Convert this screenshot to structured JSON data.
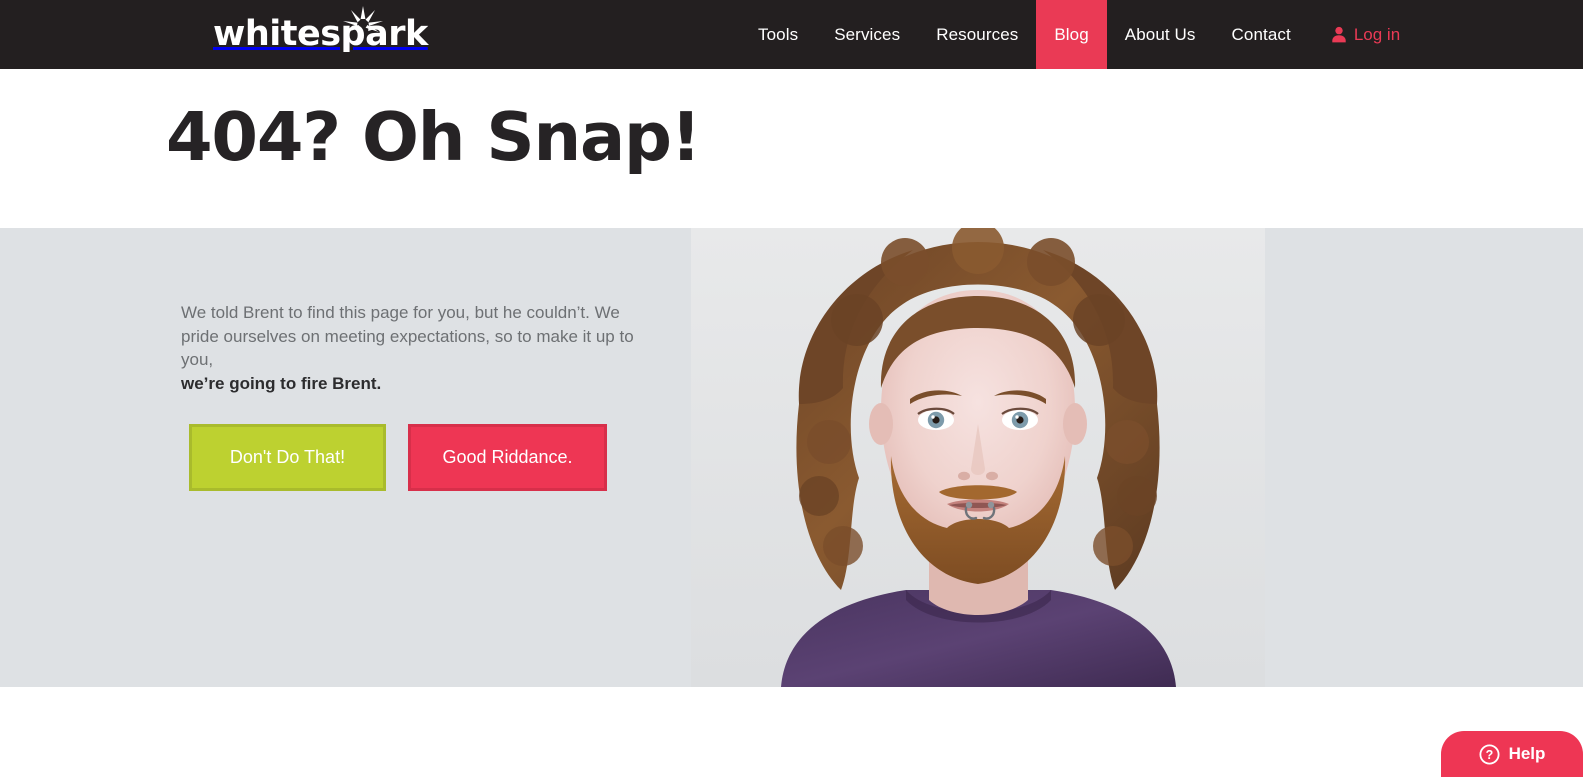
{
  "header": {
    "logo_text": "whitespark",
    "logo_icon": "spark-burst-icon",
    "nav": [
      {
        "label": "Tools",
        "active": false
      },
      {
        "label": "Services",
        "active": false
      },
      {
        "label": "Resources",
        "active": false
      },
      {
        "label": "Blog",
        "active": true
      },
      {
        "label": "About Us",
        "active": false
      },
      {
        "label": "Contact",
        "active": false
      }
    ],
    "login": {
      "label": "Log in",
      "icon": "user-icon"
    },
    "colors": {
      "background": "#231f20",
      "nav_text": "#ffffff",
      "accent": "#ea3a55"
    }
  },
  "title_band": {
    "title": "404? Oh Snap!",
    "background": "#ffffff",
    "text_color": "#262325"
  },
  "hero": {
    "background": "#dee1e4",
    "body_line_1": "We told Brent to find this page for you, but he couldn’t. We pride",
    "body_line_2": "ourselves on meeting expectations, so to make it up to you,",
    "emphasis": "we’re going to fire Brent.",
    "buttons": [
      {
        "label": "Don't Do That!",
        "color": "#bdd130",
        "border": "#a9bb2c",
        "text_color": "#ffffff"
      },
      {
        "label": "Good Riddance.",
        "color": "#ee3654",
        "border": "#d72f4a",
        "text_color": "#ffffff"
      }
    ],
    "photo": {
      "name": "brent-portrait-photo",
      "description": "Portrait photograph of a man with long curly reddish-brown hair, full ginger beard, two lip piercings, wearing a dark purple t-shirt, on a light gray studio background."
    }
  },
  "help_widget": {
    "label": "Help",
    "icon": "question-mark-circle-icon",
    "color": "#ee3654"
  }
}
